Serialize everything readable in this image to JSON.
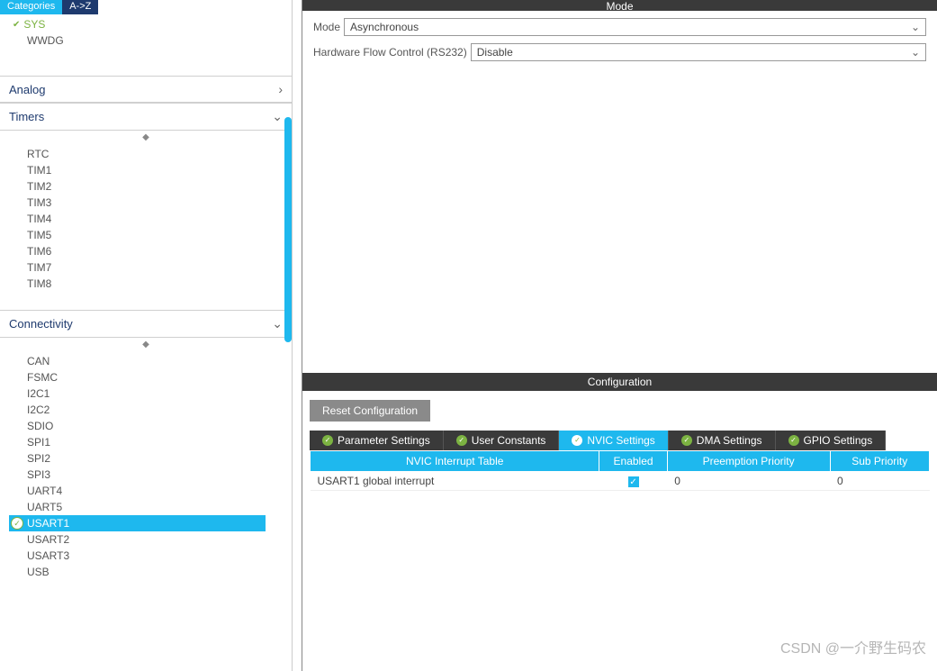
{
  "sidebar": {
    "tabs": {
      "categories": "Categories",
      "az": "A->Z"
    },
    "sys_items": {
      "sys": "SYS",
      "wwdg": "WWDG"
    },
    "sections": {
      "analog": {
        "label": "Analog"
      },
      "timers": {
        "label": "Timers",
        "items": [
          "RTC",
          "TIM1",
          "TIM2",
          "TIM3",
          "TIM4",
          "TIM5",
          "TIM6",
          "TIM7",
          "TIM8"
        ]
      },
      "connectivity": {
        "label": "Connectivity",
        "items": [
          "CAN",
          "FSMC",
          "I2C1",
          "I2C2",
          "SDIO",
          "SPI1",
          "SPI2",
          "SPI3",
          "UART4",
          "UART5",
          "USART1",
          "USART2",
          "USART3",
          "USB"
        ]
      }
    }
  },
  "mode": {
    "header": "Mode",
    "mode_label": "Mode",
    "mode_value": "Asynchronous",
    "flow_label": "Hardware Flow Control (RS232)",
    "flow_value": "Disable"
  },
  "config": {
    "header": "Configuration",
    "reset_label": "Reset Configuration",
    "tabs": {
      "param": "Parameter Settings",
      "user": "User Constants",
      "nvic": "NVIC Settings",
      "dma": "DMA Settings",
      "gpio": "GPIO Settings"
    },
    "table": {
      "headers": {
        "name": "NVIC Interrupt Table",
        "enabled": "Enabled",
        "preempt": "Preemption Priority",
        "sub": "Sub Priority"
      },
      "rows": [
        {
          "name": "USART1 global interrupt",
          "enabled": true,
          "preempt": "0",
          "sub": "0"
        }
      ]
    }
  },
  "watermark": "CSDN @一介野生码农"
}
